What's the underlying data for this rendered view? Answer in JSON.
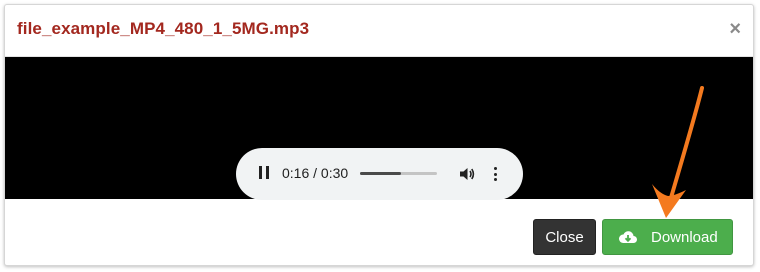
{
  "modal": {
    "title": "file_example_MP4_480_1_5MG.mp3",
    "close_symbol": "×"
  },
  "player": {
    "state": "playing",
    "time_display": "0:16 / 0:30",
    "progress_fraction": 0.53,
    "icons": {
      "pause": "pause-icon",
      "volume": "volume-icon",
      "more": "more-options-icon"
    }
  },
  "footer": {
    "close_label": "Close",
    "download_label": "Download",
    "download_icon": "cloud-download-icon"
  },
  "annotation": {
    "arrow_color": "#f47a1f",
    "points_to": "download-button"
  },
  "colors": {
    "title": "#a3281f",
    "close_button": "#333333",
    "download_button": "#4cae4c",
    "video_background": "#000000",
    "player_background": "#f1f3f4"
  }
}
